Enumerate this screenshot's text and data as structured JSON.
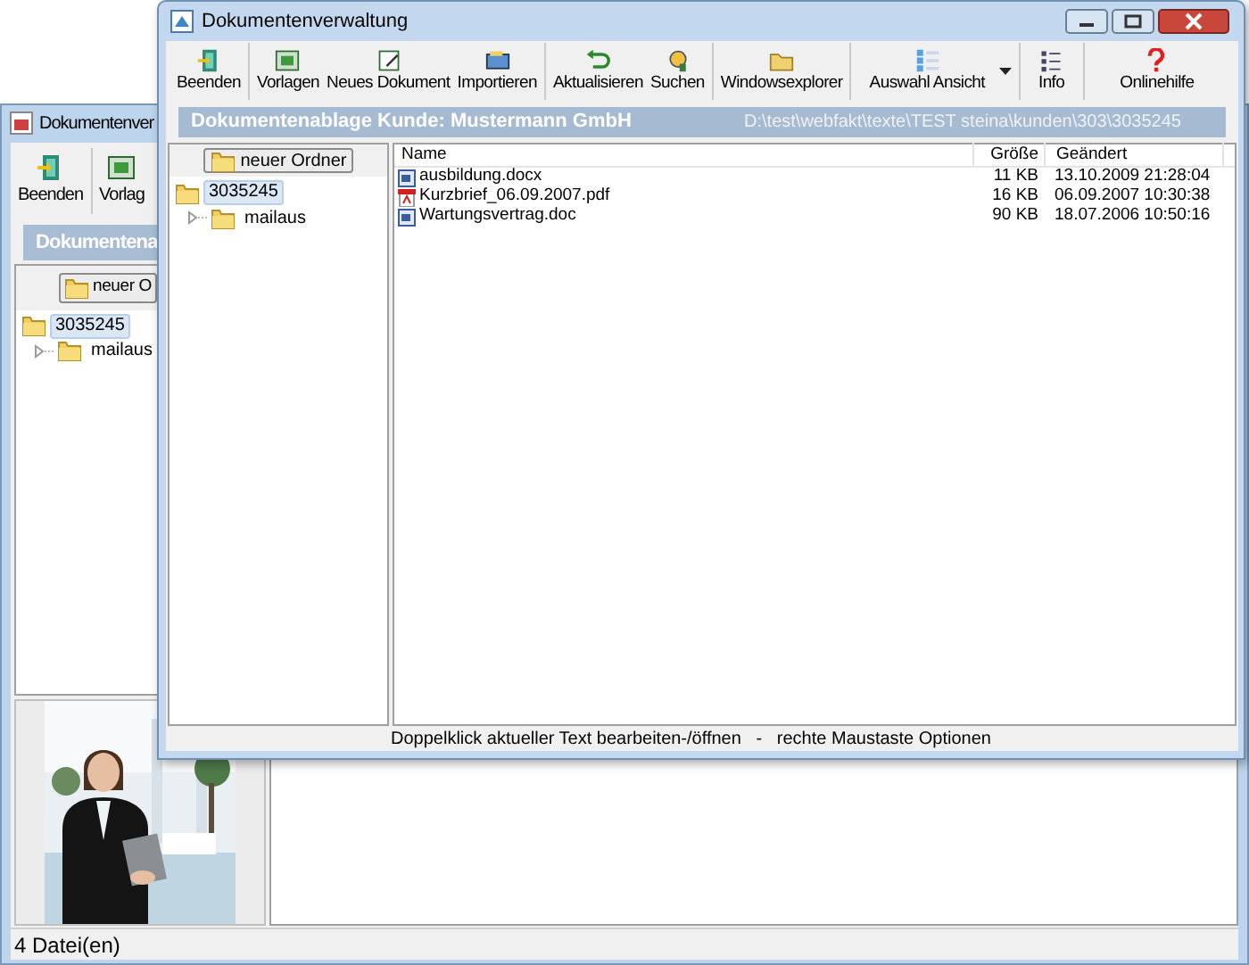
{
  "back_window": {
    "title": "Dokumentenver",
    "toolbar": [
      {
        "label": "Beenden"
      },
      {
        "label": "Vorlag"
      }
    ],
    "banner": "Dokumentena",
    "new_folder_button": "neuer O",
    "tree": [
      {
        "label": "3035245",
        "selected": true,
        "children": [
          {
            "label": "mailaus",
            "selected": false
          }
        ]
      }
    ],
    "status_bar": "4 Datei(en)"
  },
  "front_window": {
    "title": "Dokumentenverwaltung",
    "toolbar": [
      [
        {
          "label": "Beenden"
        }
      ],
      [
        {
          "label": "Vorlagen"
        },
        {
          "label": "Neues Dokument"
        },
        {
          "label": "Importieren"
        }
      ],
      [
        {
          "label": "Aktualisieren"
        },
        {
          "label": "Suchen"
        }
      ],
      [
        {
          "label": "Windowsexplorer"
        }
      ],
      [
        {
          "label": "Auswahl Ansicht",
          "dropdown": true
        }
      ],
      [
        {
          "label": "Info"
        }
      ],
      [
        {
          "label": "Onlinehilfe"
        }
      ]
    ],
    "banner": {
      "title": "Dokumentenablage Kunde: Mustermann GmbH",
      "path": "D:\\test\\webfakt\\texte\\TEST steina\\kunden\\303\\3035245"
    },
    "new_folder_button": "neuer Ordner",
    "tree": [
      {
        "label": "3035245",
        "selected": true,
        "children": [
          {
            "label": "mailaus",
            "selected": false
          }
        ]
      }
    ],
    "table": {
      "columns": [
        "Name",
        "Größe",
        "Geändert"
      ],
      "rows": [
        {
          "kind": "doc",
          "name": "ausbildung.docx",
          "size": "11 KB",
          "modified": "13.10.2009 21:28:04"
        },
        {
          "kind": "pdf",
          "name": "Kurzbrief_06.09.2007.pdf",
          "size": "16 KB",
          "modified": "06.09.2007 10:30:38"
        },
        {
          "kind": "doc",
          "name": "Wartungsvertrag.doc",
          "size": "90 KB",
          "modified": "18.07.2006 10:50:16"
        }
      ]
    },
    "status_bar": "Doppelklick aktueller Text bearbeiten-/öffnen   -   rechte Maustaste Optionen"
  }
}
